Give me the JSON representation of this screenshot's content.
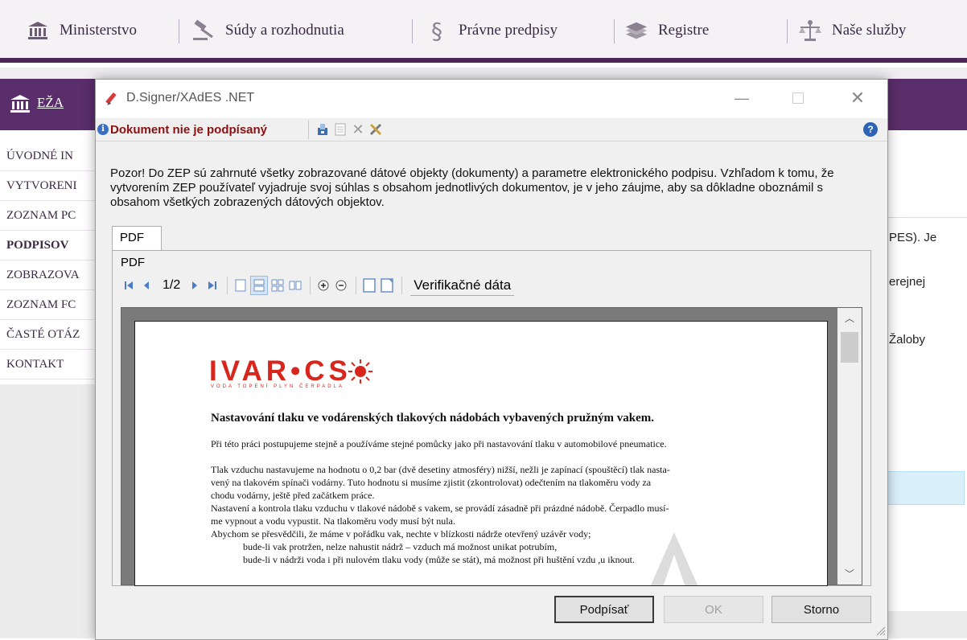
{
  "topnav": {
    "items": [
      {
        "label": "Ministerstvo",
        "icon": "bank-icon"
      },
      {
        "label": "Súdy a rozhodnutia",
        "icon": "gavel-icon"
      },
      {
        "label": "Právne predpisy",
        "icon": "paragraph-icon"
      },
      {
        "label": "Registre",
        "icon": "books-icon"
      },
      {
        "label": "Naše služby",
        "icon": "scales-icon"
      }
    ]
  },
  "portal": {
    "header_title": "EŽA",
    "menu": [
      "ÚVODNÉ IN",
      "VYTVORENI",
      "ZOZNAM PC",
      "PODPISOV",
      "ZOBRAZOVA",
      "ZOZNAM FC",
      "ČASTÉ OTÁZ",
      "KONTAKT"
    ],
    "right_fragments": [
      "PES). Je",
      "erejnej",
      "Žaloby"
    ]
  },
  "dialog": {
    "title": "D.Signer/XAdES .NET",
    "status": "Dokument nie je podpísaný",
    "help_glyph": "?",
    "notice": "Pozor! Do ZEP sú zahrnuté všetky zobrazované dátové objekty (dokumenty) a parametre elektronického podpisu. Vzhľadom k tomu, že vytvorením ZEP používateľ vyjadruje svoj súhlas s obsahom jednotlivých dokumentov, je v jeho záujme, aby sa dôkladne oboznámil s obsahom všetkých zobrazených dátových objektov.",
    "tab_label": "PDF",
    "panel_label": "PDF",
    "page_indicator": "1/2",
    "verification_label": "Verifikačné dáta",
    "buttons": {
      "sign": "Podpísať",
      "ok": "OK",
      "cancel": "Storno"
    }
  },
  "document": {
    "logo": "IVAR•CS",
    "logo_sub": "VODA TOPENÍ PLYN ČERPADLA",
    "heading": "Nastavování tlaku ve vodárenských tlakových nádobách vybavených pružným vakem.",
    "p1": "Při této práci postupujeme stejně a používáme stejné pomůcky jako při nastavování tlaku v automobilové pneumatice.",
    "p2a": "Tlak vzduchu nastavujeme na hodnotu o 0,2 bar (dvě desetiny atmosféry) nižší, nežli je zapínací (spouštěcí) tlak nasta-",
    "p2b": "vený na tlakovém spínači vodárny. Tuto hodnotu si musíme zjistit (zkontrolovat) odečtením na tlakoměru vody za",
    "p2c": "chodu vodárny, ještě před začátkem práce.",
    "p3a": "Nastavení a kontrola tlaku vzduchu v tlakové nádobě s vakem, se provádí zásadně při prázdné nádobě. Čerpadlo musí-",
    "p3b": "me vypnout a vodu vypustit. Na tlakoměru vody musí být nula.",
    "p4": "Abychom se přesvědčili, že máme v pořádku vak, nechte v blízkosti nádrže otevřený uzávěr vody;",
    "p5": "bude-li vak protržen, nelze nahustit nádrž – vzduch má možnost unikat potrubím,",
    "p6": "bude-li v nádrži voda i při nulovém tlaku vody (může se stát), má možnost při huštění vzdu  ,u  iknout."
  },
  "colors": {
    "brand_purple": "#5a2e6a",
    "status_red": "#8b1111",
    "logo_red": "#d9261c"
  }
}
